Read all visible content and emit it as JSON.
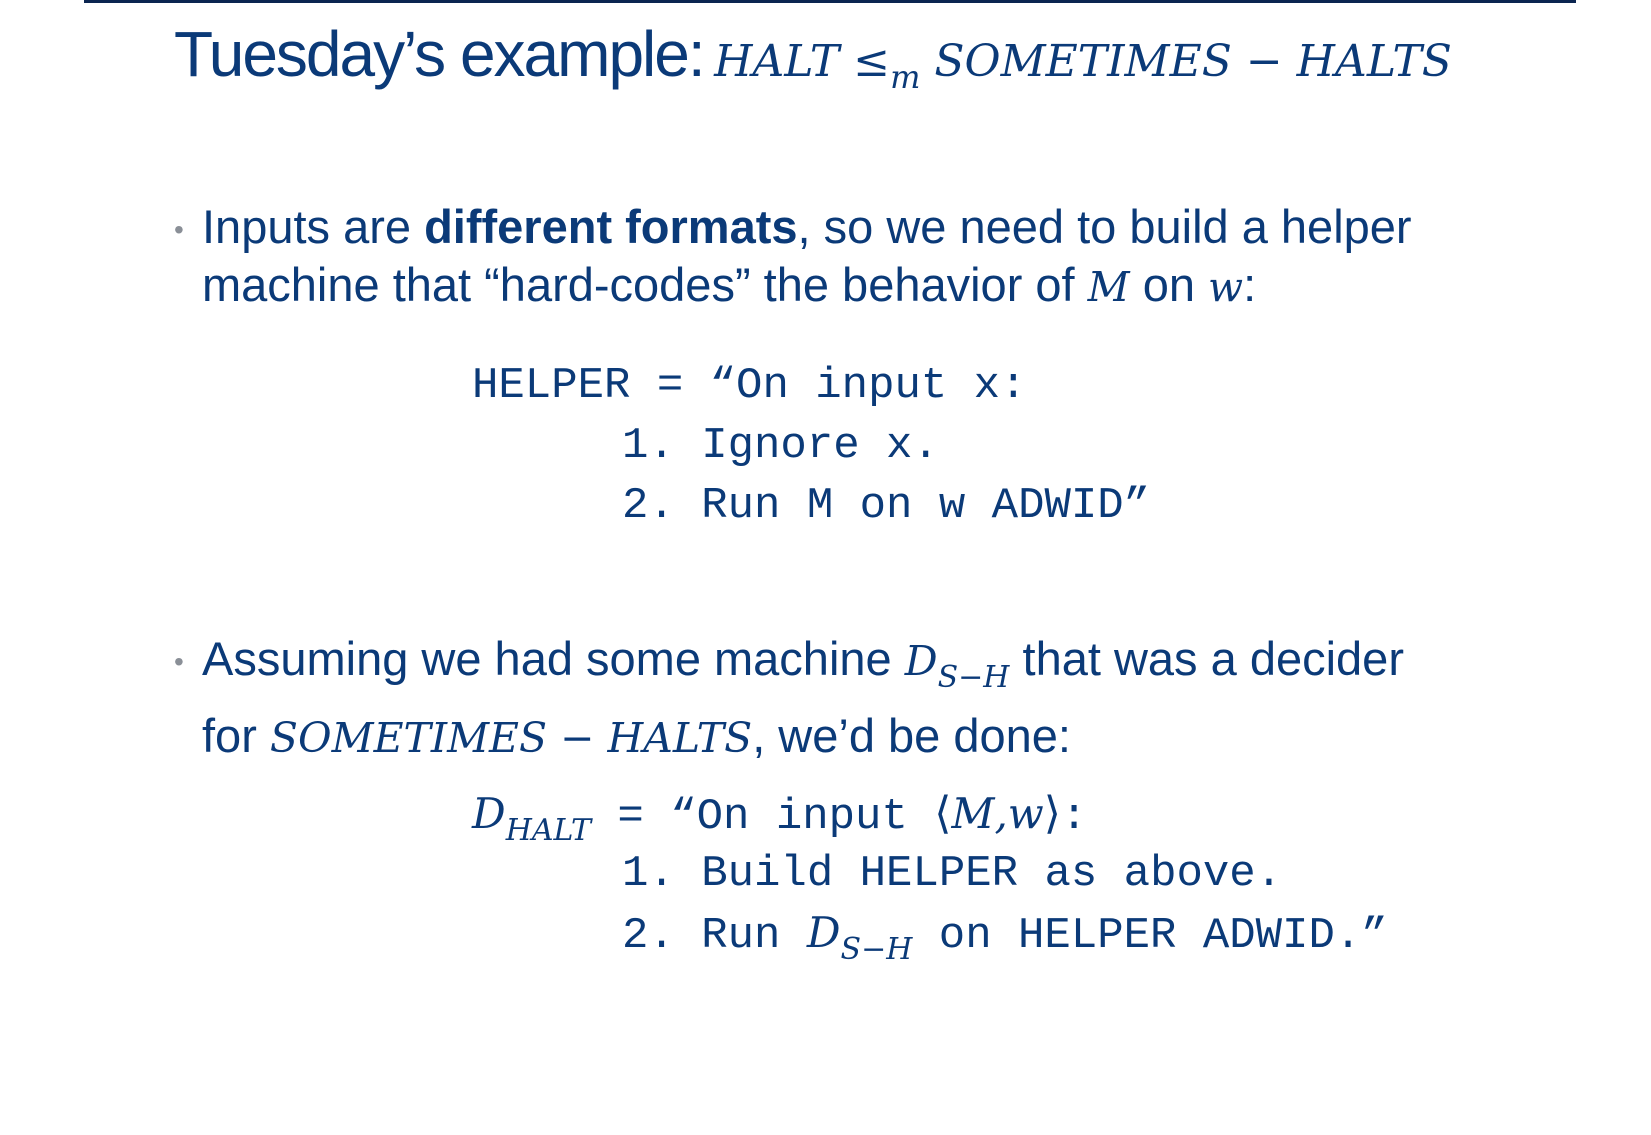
{
  "title": {
    "text": "Tuesday’s example:",
    "math_left": "HALT ≤",
    "math_sub": "m",
    "math_right": "SOMETIMES − HALTS"
  },
  "bullet1": {
    "line1_pre": "Inputs are ",
    "line1_bold": "different formats",
    "line1_post": ", so we need to build a helper",
    "line2_pre": "machine that “hard-codes” the behavior of ",
    "line2_M": "M",
    "line2_mid": " on ",
    "line2_w": "w",
    "line2_post": ":"
  },
  "helper": {
    "line0": "HELPER = “On input x:",
    "line1": "1. Ignore x.",
    "line2": "2. Run M on w ADWID”"
  },
  "bullet2": {
    "line1_pre": "Assuming we had some machine ",
    "line1_D": "D",
    "line1_sub": "S−H",
    "line1_post": " that was a decider",
    "line2_pre": "for ",
    "line2_math": "SOMETIMES − HALTS",
    "line2_post": ", we’d be done:"
  },
  "dhalt": {
    "D": "D",
    "sub": "HALT",
    "line0_mid": " = “On input ",
    "angle_open": "⟨",
    "line0_math": "M,w",
    "angle_close": "⟩",
    "line0_post": ":",
    "line1": "1. Build HELPER as above.",
    "line2_pre": "2. Run ",
    "line2_D": "D",
    "line2_sub": "S−H",
    "line2_post": " on HELPER ADWID.”"
  }
}
